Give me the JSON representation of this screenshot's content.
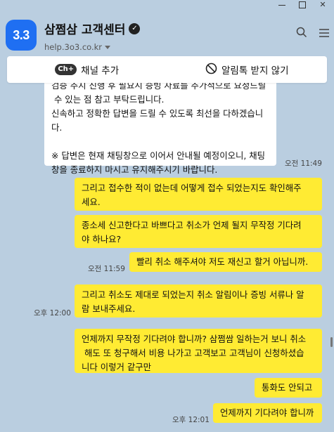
{
  "header": {
    "logo_text": "3.3",
    "title": "삼쩜삼 고객센터",
    "verified_symbol": "✓",
    "subtitle": "help.3o3.co.kr"
  },
  "action_bar": {
    "add_channel_badge": "Ch+",
    "add_channel_label": "채널 추가",
    "mute_label": "알림톡 받지 않기"
  },
  "messages": {
    "m0": {
      "text": "검증 추지 진행 후 필요시 증빙 자료를 추가적으로 요청드릴\n 수 있는 점 참고 부탁드립니다.\n신속하고 정확한 답변을 드릴 수 있도록 최선을 다하겠습니\n다.\n\n※ 답변은 현재 채팅창으로 이어서 안내될 예정이오니, 채팅\n창을 종료하지 마시고 유지해주시기 바랍니다.",
      "time": "오전 11:49"
    },
    "m1": {
      "text": "그리고 접수한 적이 없는데 어떻게 접수 되었는지도 확인해주\n세요."
    },
    "m2": {
      "text": "종소세 신고한다고 바쁘다고 취소가 언제 될지 무작정 기다려\n야 하나요?"
    },
    "m3": {
      "text": "빨리 취소 해주셔야 저도 재신고 할거 아닙니까.",
      "time": "오전 11:59"
    },
    "m4": {
      "text": "그리고 취소도 제대로 되었는지 취소 알림이나 증빙 서류나 알\n람 보내주세요.",
      "time": "오후 12:00"
    },
    "m5": {
      "text": "언제까지 무작정 기다려야 합니까? 삼쩜쌈 일하는거 보니 취소\n 해도 또 청구해서 비용 나가고 고객보고 고객님이 신청하셨습\n니다 이렇거 같구만"
    },
    "m6": {
      "text": "통화도 안되고"
    },
    "m7": {
      "text": "언제까지 기다려야 합니까",
      "time": "오후 12:01"
    }
  }
}
